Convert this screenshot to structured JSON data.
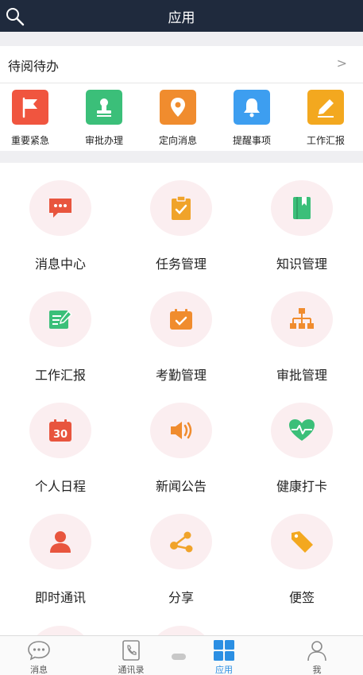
{
  "header": {
    "title": "应用"
  },
  "pending": {
    "label": "待阅待办",
    "chevron": ">"
  },
  "quick_actions": [
    {
      "label": "重要紧急",
      "icon": "flag-icon",
      "color": "#f0553f"
    },
    {
      "label": "审批办理",
      "icon": "stamp-icon",
      "color": "#3bbf79"
    },
    {
      "label": "定向消息",
      "icon": "location-pin-icon",
      "color": "#f08c2e"
    },
    {
      "label": "提醒事项",
      "icon": "bell-icon",
      "color": "#3d9ef0"
    },
    {
      "label": "工作汇报",
      "icon": "pencil-icon",
      "color": "#f3a81f"
    }
  ],
  "apps": [
    {
      "label": "消息中心",
      "icon": "chat-bubble-icon",
      "color": "#e8553e"
    },
    {
      "label": "任务管理",
      "icon": "clipboard-check-icon",
      "color": "#f0a32a"
    },
    {
      "label": "知识管理",
      "icon": "book-icon",
      "color": "#3bbf79"
    },
    {
      "label": "工作汇报",
      "icon": "report-edit-icon",
      "color": "#3bbf79"
    },
    {
      "label": "考勤管理",
      "icon": "calendar-check-icon",
      "color": "#f08c2e"
    },
    {
      "label": "审批管理",
      "icon": "org-chart-icon",
      "color": "#f08c2e"
    },
    {
      "label": "个人日程",
      "icon": "calendar-30-icon",
      "color": "#e8553e",
      "badge": "30"
    },
    {
      "label": "新闻公告",
      "icon": "speaker-icon",
      "color": "#f08c2e"
    },
    {
      "label": "健康打卡",
      "icon": "heart-pulse-icon",
      "color": "#3bbf79"
    },
    {
      "label": "即时通讯",
      "icon": "person-icon",
      "color": "#e8553e"
    },
    {
      "label": "分享",
      "icon": "share-icon",
      "color": "#f0a32a"
    },
    {
      "label": "便签",
      "icon": "tag-icon",
      "color": "#f3a81f"
    }
  ],
  "tabs": [
    {
      "label": "消息",
      "icon": "chat-bubble-outline-icon"
    },
    {
      "label": "通讯录",
      "icon": "phone-book-icon"
    },
    {
      "label": "应用",
      "icon": "apps-grid-icon",
      "active": true
    },
    {
      "label": "我",
      "icon": "user-outline-icon"
    }
  ],
  "colors": {
    "header_bg": "#1f2a3d",
    "active_tab": "#2b8fe3",
    "icon_bg": "#fbeef0"
  }
}
